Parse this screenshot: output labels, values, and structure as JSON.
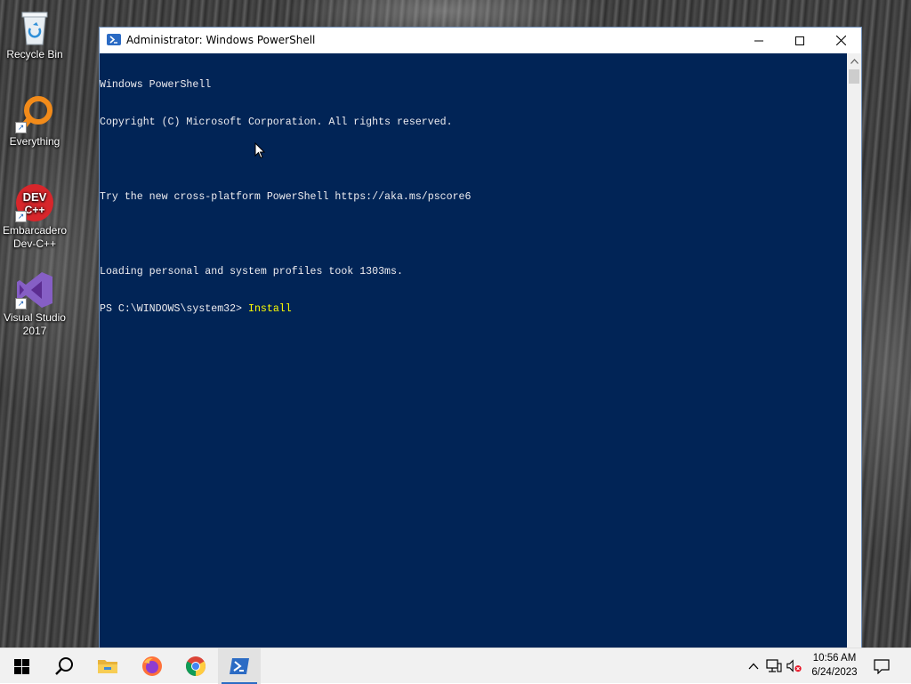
{
  "desktop": {
    "icons": [
      {
        "label": "Recycle Bin"
      },
      {
        "label": "Everything"
      },
      {
        "label": "Embarcadero Dev-C++"
      },
      {
        "label": "Visual Studio 2017"
      }
    ]
  },
  "window": {
    "title": "Administrator: Windows PowerShell",
    "icon": "powershell-icon",
    "controls": [
      "minimize-icon",
      "maximize-icon",
      "close-icon"
    ]
  },
  "console": {
    "lines": [
      "Windows PowerShell",
      "Copyright (C) Microsoft Corporation. All rights reserved.",
      "",
      "Try the new cross-platform PowerShell https://aka.ms/pscore6",
      "",
      "Loading personal and system profiles took 1303ms."
    ],
    "prompt": "PS C:\\WINDOWS\\system32> ",
    "command": "Install",
    "background": "#012456",
    "foreground": "#eeedf0",
    "command_color": "#ffff00"
  },
  "taskbar": {
    "items": [
      "windows-start-icon",
      "search-icon",
      "file-explorer-icon",
      "firefox-icon",
      "chrome-icon",
      "powershell-icon"
    ],
    "active": "powershell-icon",
    "clock": {
      "time": "10:56 AM",
      "date": "6/24/2023"
    }
  }
}
